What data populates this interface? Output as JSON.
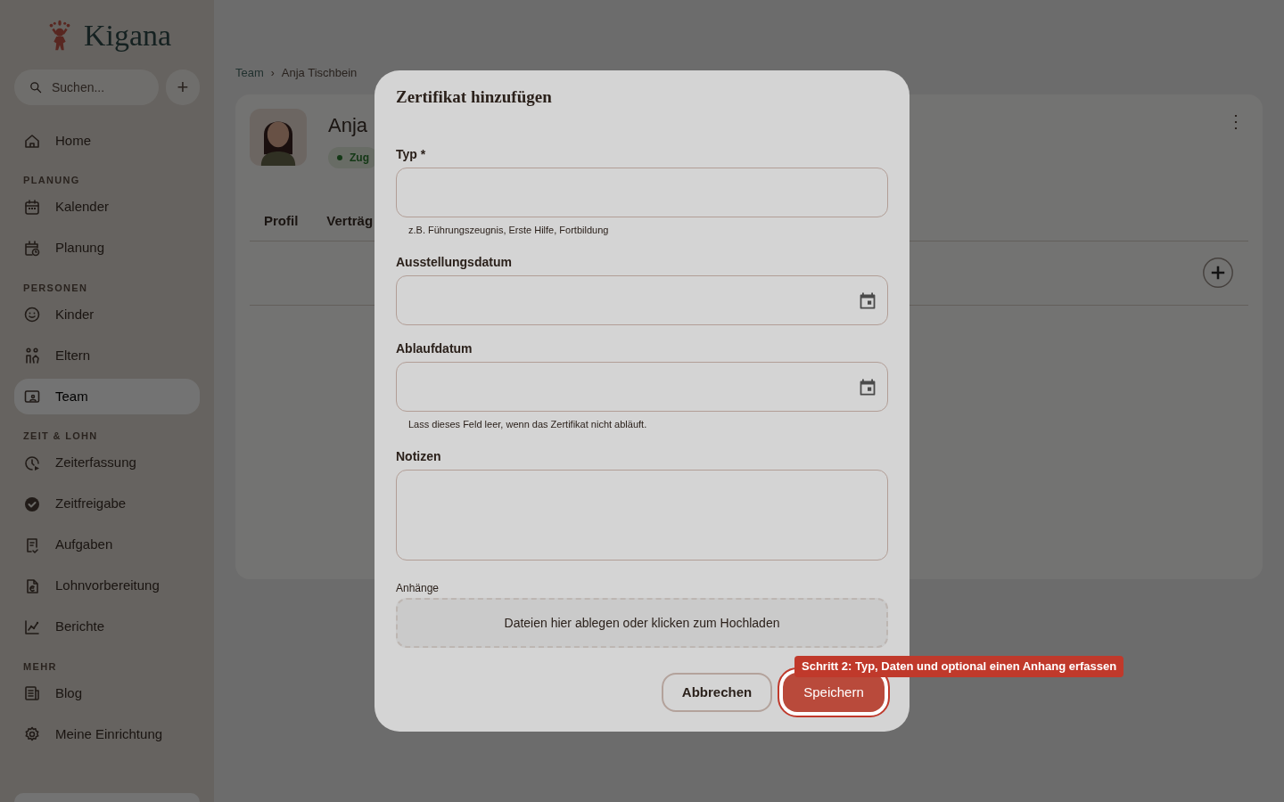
{
  "sidebar": {
    "logo": "Kigana",
    "search": {
      "placeholder": "Suchen..."
    },
    "add_button": "+",
    "sections": [
      {
        "items": [
          {
            "label": "Home",
            "selected": false
          }
        ]
      },
      {
        "title": "PLANUNG",
        "items": [
          {
            "label": "Kalender",
            "selected": false
          },
          {
            "label": "Planung",
            "selected": false
          }
        ]
      },
      {
        "title": "PERSONEN",
        "items": [
          {
            "label": "Kinder",
            "selected": false
          },
          {
            "label": "Eltern",
            "selected": false
          },
          {
            "label": "Team",
            "selected": true
          }
        ]
      },
      {
        "title": "ZEIT & LOHN",
        "items": [
          {
            "label": "Zeiterfassung",
            "selected": false
          },
          {
            "label": "Zeitfreigabe",
            "selected": false
          },
          {
            "label": "Aufgaben",
            "selected": false
          },
          {
            "label": "Lohnvorbereitung",
            "selected": false
          },
          {
            "label": "Berichte",
            "selected": false
          }
        ]
      },
      {
        "title": "MEHR",
        "items": [
          {
            "label": "Blog",
            "selected": false
          },
          {
            "label": "Meine Einrichtung",
            "selected": false
          }
        ]
      }
    ]
  },
  "breadcrumb": {
    "items": [
      "Team",
      "Anja Tischbein"
    ],
    "separator": "›"
  },
  "profile": {
    "name": "Anja",
    "status": "Zug",
    "more_button": "⋮",
    "tabs": [
      {
        "label": "Profil",
        "selected": false
      },
      {
        "label": "Verträg",
        "selected": false
      }
    ]
  },
  "dialog": {
    "title": "Zertifikat hinzufügen",
    "fields": [
      {
        "kind": "text",
        "label": "Typ *",
        "helper": "z.B. Führungszeugnis, Erste Hilfe, Fortbildung"
      },
      {
        "kind": "date",
        "label": "Ausstellungsdatum"
      },
      {
        "kind": "date",
        "label": "Ablaufdatum",
        "helper": "Lass dieses Feld leer, wenn das Zertifikat nicht abläuft."
      },
      {
        "kind": "textarea",
        "label": "Notizen"
      },
      {
        "kind": "upload",
        "label": "Anhänge",
        "text": "Dateien hier ablegen oder klicken zum Hochladen"
      }
    ],
    "buttons": [
      {
        "label": "Abbrechen",
        "kind": "secondary"
      },
      {
        "label": "Speichern",
        "kind": "primary",
        "highlighted": true
      }
    ]
  },
  "tour_tooltip": "Schritt 2: Typ, Daten und optional einen Anhang erfassen"
}
